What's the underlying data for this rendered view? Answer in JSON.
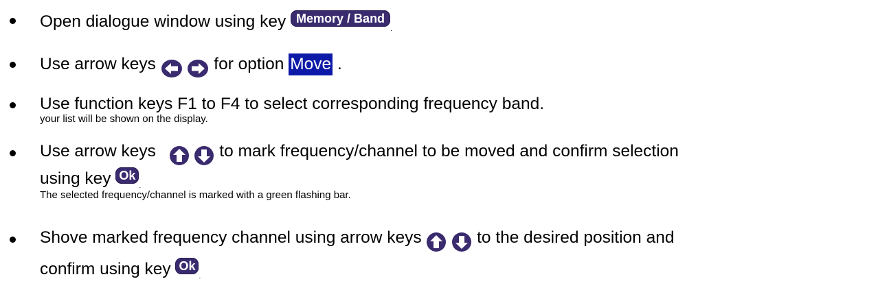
{
  "items": [
    {
      "text_before": "Open dialogue window using key",
      "key": "Memory / Band",
      "trail": "."
    },
    {
      "text_before": "Use arrow keys",
      "arrows": [
        "arrow-left-icon",
        "arrow-right-icon"
      ],
      "text_mid": "for option",
      "highlight": "Move",
      "trail": "."
    },
    {
      "text": "Use function keys F1 to F4 to select corresponding frequency band.",
      "note": "your list will be shown on the display."
    },
    {
      "text_before": "Use arrow keys",
      "arrows": [
        "arrow-up-icon",
        "arrow-down-icon"
      ],
      "text_after": "to mark frequency/channel to be moved and confirm selection",
      "line2_before": "using key",
      "key": "Ok",
      "trail": ".",
      "note": "The selected frequency/channel is marked with a green flashing bar."
    },
    {
      "text_before": "Shove marked frequency channel using arrow keys",
      "arrows": [
        "arrow-up-icon",
        "arrow-down-icon"
      ],
      "text_after": "to the desired position and",
      "line2_before": "confirm using key",
      "key": "Ok",
      "trail": "."
    }
  ],
  "colors": {
    "keycap": "#3a2a6e",
    "highlight": "#0d1aa8"
  }
}
